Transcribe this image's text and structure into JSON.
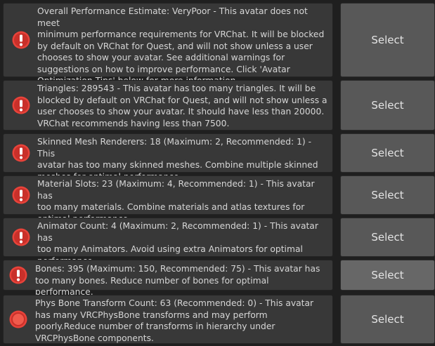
{
  "colors": {
    "panel_bg": "#383838",
    "button_bg": "#585858",
    "error_red": "#e8433a",
    "text": "#d6d6d6"
  },
  "warnings": [
    {
      "icon": "error-exclamation-icon",
      "message": "Overall Performance Estimate: VeryPoor - This avatar does not meet\nminimum performance requirements for VRChat. It will be blocked\nby default on VRChat for Quest, and will not show unless a user\nchooses to show your avatar. See additional warnings for\nsuggestions on how to improve performance. Click 'Avatar\nOptimization Tips' below for more information.",
      "button": "Select"
    },
    {
      "icon": "error-exclamation-icon",
      "message": "Triangles: 289543 - This avatar has too many triangles. It will be\nblocked by default on VRChat for Quest, and will not show unless a\nuser chooses to show your avatar. It should have less than 20000.\nVRChat recommends having less than 7500.",
      "button": "Select"
    },
    {
      "icon": "error-exclamation-icon",
      "message": "Skinned Mesh Renderers: 18 (Maximum: 2, Recommended: 1) - This\navatar has too many skinned meshes. Combine multiple skinned\nmeshes for optimal performance.",
      "button": "Select"
    },
    {
      "icon": "error-exclamation-icon",
      "message": "Material Slots: 23 (Maximum: 4, Recommended: 1) - This avatar has\ntoo many materials. Combine materials and atlas textures for\noptimal performance.",
      "button": "Select"
    },
    {
      "icon": "error-exclamation-icon",
      "message": "Animator Count: 4 (Maximum: 2, Recommended: 1) - This avatar has\ntoo many Animators. Avoid using extra Animators for optimal\nperformance.",
      "button": "Select"
    },
    {
      "icon": "error-exclamation-icon",
      "message": "Bones: 395 (Maximum: 150, Recommended: 75) - This avatar has\ntoo many bones. Reduce number of bones for optimal performance.",
      "button": "Select"
    },
    {
      "icon": "error-dot-icon",
      "message": "Phys Bone Transform Count: 63 (Recommended: 0) - This avatar\nhas many VRCPhysBone transforms and may perform\npoorly.Reduce number of transforms in hierarchy under\nVRCPhysBone components.",
      "button": "Select"
    }
  ]
}
